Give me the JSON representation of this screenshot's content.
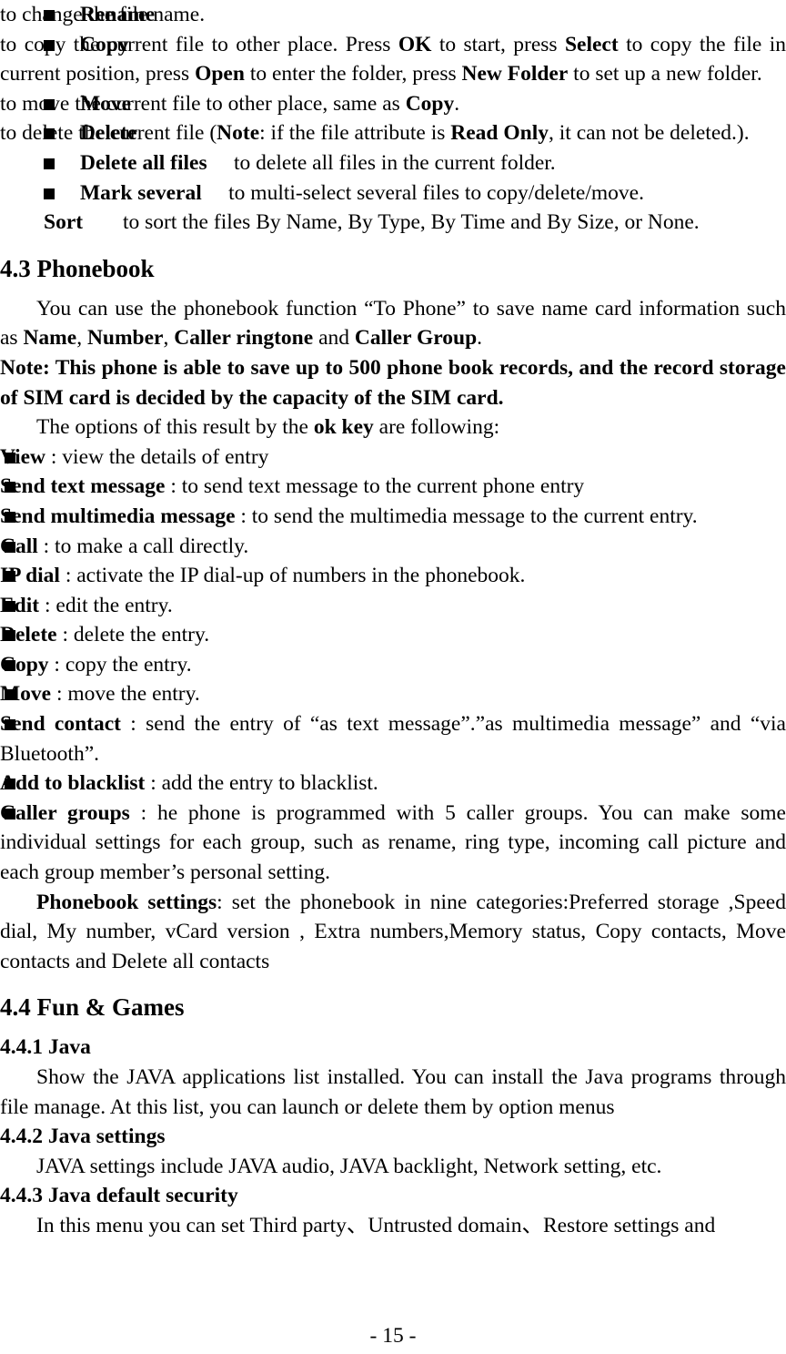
{
  "page": {
    "number_label": "- 15 -"
  },
  "file_options": {
    "items": [
      {
        "label": "Rename",
        "desc": "to change the file name."
      },
      {
        "label": "Copy",
        "desc_parts": [
          {
            "t": "to copy the current file to other place. Press ",
            "b": false
          },
          {
            "t": "OK",
            "b": true
          },
          {
            "t": " to start, press ",
            "b": false
          },
          {
            "t": "Select",
            "b": true
          },
          {
            "t": " to copy the file in current position, press ",
            "b": false
          },
          {
            "t": "Open",
            "b": true
          },
          {
            "t": " to enter the folder, press ",
            "b": false
          },
          {
            "t": "New Folder",
            "b": true
          },
          {
            "t": " to set up a new folder.",
            "b": false
          }
        ]
      },
      {
        "label": "Move",
        "desc_parts": [
          {
            "t": "to move the current file to other place, same as ",
            "b": false
          },
          {
            "t": "Copy",
            "b": true
          },
          {
            "t": ".",
            "b": false
          }
        ]
      },
      {
        "label": "Delete",
        "desc_parts": [
          {
            "t": "to delete the current file (",
            "b": false
          },
          {
            "t": "Note",
            "b": true
          },
          {
            "t": ": if the file attribute is ",
            "b": false
          },
          {
            "t": "Read Only",
            "b": true
          },
          {
            "t": ", it can not be deleted.).",
            "b": false
          }
        ]
      },
      {
        "label": "Delete all files",
        "desc": "to delete all files in the current folder."
      },
      {
        "label": "Mark several",
        "desc": "to multi-select several files to copy/delete/move."
      }
    ],
    "sort": {
      "label": "Sort",
      "desc": "to sort the files By Name, By Type, By Time and By Size, or None."
    }
  },
  "section_43": {
    "heading": "4.3 Phonebook",
    "intro_parts": [
      {
        "t": "You can use the phonebook function “To Phone” to save name card information such as ",
        "b": false
      },
      {
        "t": "Name",
        "b": true
      },
      {
        "t": ", ",
        "b": false
      },
      {
        "t": "Number",
        "b": true
      },
      {
        "t": ", ",
        "b": false
      },
      {
        "t": "Caller ringtone",
        "b": true
      },
      {
        "t": " and ",
        "b": false
      },
      {
        "t": "Caller Group",
        "b": true
      },
      {
        "t": ".",
        "b": false
      }
    ],
    "note": "Note: This phone is able to save up to 500 phone book records, and the record storage of SIM card is decided by the capacity of the SIM card.",
    "options_lead_parts": [
      {
        "t": "The options of this result by the ",
        "b": false
      },
      {
        "t": "ok key",
        "b": true
      },
      {
        "t": " are following:",
        "b": false
      }
    ],
    "options": [
      {
        "label": "View",
        "desc": " : view the details of entry"
      },
      {
        "label": "Send text message",
        "desc": " : to send text message to the current phone entry"
      },
      {
        "label": "Send multimedia message",
        "desc": " : to send the multimedia message to the current entry."
      },
      {
        "label": "Call",
        "desc": " : to make a call directly."
      },
      {
        "label": "IP dial",
        "desc": " : activate the IP dial-up of numbers in the phonebook."
      },
      {
        "label": "Edit",
        "desc": " : edit the entry."
      },
      {
        "label": "Delete",
        "desc": " : delete the entry."
      },
      {
        "label": "Copy",
        "desc": " : copy the entry."
      },
      {
        "label": "Move",
        "desc": " : move the entry."
      },
      {
        "label": "Send contact",
        "desc": " : send the entry of “as text message”.”as multimedia message” and “via Bluetooth”."
      },
      {
        "label": "Add to blacklist",
        "desc": " : add the entry to blacklist."
      },
      {
        "label": "Caller groups",
        "desc": " : he phone is programmed with 5 caller groups. You can make some individual settings for each group, such as rename, ring type, incoming call picture and each group member’s personal setting."
      }
    ],
    "settings_parts": [
      {
        "t": "Phonebook settings",
        "b": true
      },
      {
        "t": ": set the phonebook in nine categories:Preferred storage ,Speed dial, My number, vCard version , Extra numbers,Memory status, Copy contacts, Move contacts and Delete all contacts",
        "b": false
      }
    ]
  },
  "section_44": {
    "heading": "4.4 Fun & Games",
    "sub_441": {
      "heading": "4.4.1 Java",
      "body": "Show the JAVA applications list installed. You can install the Java programs through file manage. At this list, you can launch or delete them by option menus"
    },
    "sub_442": {
      "heading": "4.4.2 Java settings",
      "body": "JAVA settings include JAVA audio, JAVA backlight, Network setting, etc."
    },
    "sub_443": {
      "heading": "4.4.3 Java default security",
      "body": "In this menu you can set Third party、Untrusted domain、Restore settings and"
    }
  }
}
